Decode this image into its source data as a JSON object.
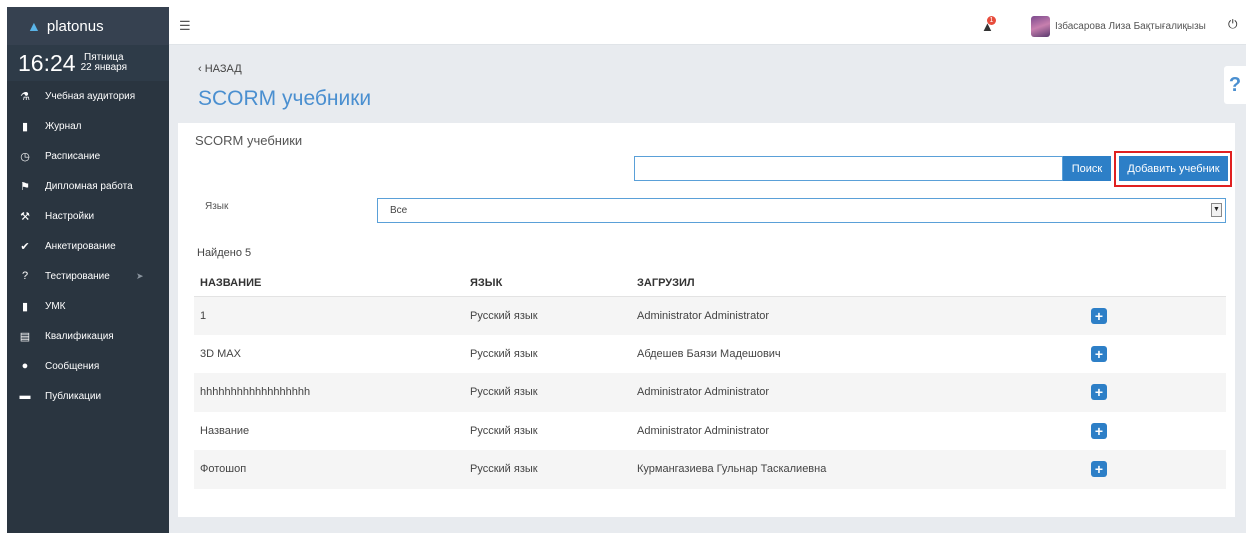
{
  "app": {
    "logo_text": "platonus"
  },
  "clock": {
    "time": "16:24",
    "weekday": "Пятница",
    "date": "22 января"
  },
  "sidebar": {
    "items": [
      {
        "label": "Учебная аудитория",
        "icon": "users-icon"
      },
      {
        "label": "Журнал",
        "icon": "book-icon"
      },
      {
        "label": "Расписание",
        "icon": "clock-icon"
      },
      {
        "label": "Дипломная работа",
        "icon": "graduation-cap-icon"
      },
      {
        "label": "Настройки",
        "icon": "wrench-icon"
      },
      {
        "label": "Анкетирование",
        "icon": "check-circle-icon"
      },
      {
        "label": "Тестирование",
        "icon": "question-circle-icon",
        "has_arrow": true
      },
      {
        "label": "УМК",
        "icon": "book-icon"
      },
      {
        "label": "Квалификация",
        "icon": "certificate-icon"
      },
      {
        "label": "Сообщения",
        "icon": "comments-icon"
      },
      {
        "label": "Публикации",
        "icon": "folder-open-icon"
      }
    ]
  },
  "topbar": {
    "notification_count": "1",
    "user_name": "Ізбасарова Лиза Бақтығалиқызы"
  },
  "page": {
    "back_label": "НАЗАД",
    "title": "SCORM учебники",
    "help_label": "?"
  },
  "panel": {
    "title": "SCORM учебники",
    "search": {
      "value": "",
      "placeholder": ""
    },
    "search_button": "Поиск",
    "add_button": "Добавить учебник",
    "lang_label": "Язык",
    "lang_value": "Все",
    "found_text": "Найдено 5"
  },
  "table": {
    "headers": {
      "name": "НАЗВАНИЕ",
      "lang": "ЯЗЫК",
      "uploader": "ЗАГРУЗИЛ"
    },
    "rows": [
      {
        "name": "1",
        "lang": "Русский язык",
        "uploader": "Administrator Administrator"
      },
      {
        "name": "3D MAX",
        "lang": "Русский язык",
        "uploader": "Абдешев Баязи Мадешович"
      },
      {
        "name": "hhhhhhhhhhhhhhhhhh",
        "lang": "Русский язык",
        "uploader": "Administrator Administrator"
      },
      {
        "name": "Название",
        "lang": "Русский язык",
        "uploader": "Administrator Administrator"
      },
      {
        "name": "Фотошоп",
        "lang": "Русский язык",
        "uploader": "Курмангазиева Гульнар Таскалиевна"
      }
    ]
  },
  "colors": {
    "sidebar_bg": "#2a3540",
    "accent": "#2d7fc7",
    "title_blue": "#4a8fd0",
    "highlight_red": "#e02020"
  }
}
